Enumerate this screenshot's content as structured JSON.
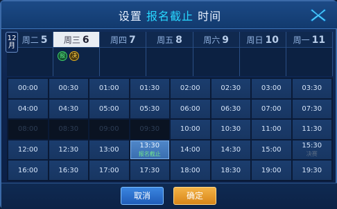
{
  "title": {
    "prefix": "设置",
    "highlight": "报名截止",
    "suffix": "时间"
  },
  "month_badge": {
    "number": "12",
    "unit": "月"
  },
  "days": [
    {
      "label": "周二",
      "date": "5",
      "selected": false
    },
    {
      "label": "周三",
      "date": "6",
      "selected": true,
      "badges": [
        "报",
        "决"
      ]
    },
    {
      "label": "周四",
      "date": "7",
      "selected": false
    },
    {
      "label": "周五",
      "date": "8",
      "selected": false
    },
    {
      "label": "周六",
      "date": "9",
      "selected": false
    },
    {
      "label": "周日",
      "date": "10",
      "selected": false
    },
    {
      "label": "周一",
      "date": "11",
      "selected": false
    }
  ],
  "slots": [
    {
      "time": "00:00",
      "state": "normal"
    },
    {
      "time": "00:30",
      "state": "normal"
    },
    {
      "time": "01:00",
      "state": "normal"
    },
    {
      "time": "01:30",
      "state": "normal"
    },
    {
      "time": "02:00",
      "state": "normal"
    },
    {
      "time": "02:30",
      "state": "normal"
    },
    {
      "time": "03:00",
      "state": "normal"
    },
    {
      "time": "03:30",
      "state": "normal"
    },
    {
      "time": "04:00",
      "state": "normal"
    },
    {
      "time": "04:30",
      "state": "normal"
    },
    {
      "time": "05:00",
      "state": "normal"
    },
    {
      "time": "05:30",
      "state": "normal"
    },
    {
      "time": "06:00",
      "state": "normal"
    },
    {
      "time": "06:30",
      "state": "normal"
    },
    {
      "time": "07:00",
      "state": "normal"
    },
    {
      "time": "07:30",
      "state": "normal"
    },
    {
      "time": "08:00",
      "state": "disabled"
    },
    {
      "time": "08:30",
      "state": "disabled"
    },
    {
      "time": "09:00",
      "state": "disabled"
    },
    {
      "time": "09:30",
      "state": "disabled"
    },
    {
      "time": "10:00",
      "state": "normal"
    },
    {
      "time": "10:30",
      "state": "normal"
    },
    {
      "time": "11:00",
      "state": "normal"
    },
    {
      "time": "11:30",
      "state": "normal"
    },
    {
      "time": "12:00",
      "state": "normal"
    },
    {
      "time": "12:30",
      "state": "normal"
    },
    {
      "time": "13:00",
      "state": "normal"
    },
    {
      "time": "13:30",
      "state": "active",
      "note": "报名截止"
    },
    {
      "time": "14:00",
      "state": "normal"
    },
    {
      "time": "14:30",
      "state": "normal"
    },
    {
      "time": "15:00",
      "state": "normal"
    },
    {
      "time": "15:30",
      "state": "normal",
      "note": "决赛",
      "note_dim": true
    },
    {
      "time": "16:00",
      "state": "normal"
    },
    {
      "time": "16:30",
      "state": "normal"
    },
    {
      "time": "17:00",
      "state": "normal"
    },
    {
      "time": "17:30",
      "state": "normal"
    },
    {
      "time": "18:00",
      "state": "normal"
    },
    {
      "time": "18:30",
      "state": "normal"
    },
    {
      "time": "19:00",
      "state": "normal"
    },
    {
      "time": "19:30",
      "state": "normal"
    }
  ],
  "buttons": {
    "cancel": "取消",
    "confirm": "确定"
  },
  "colors": {
    "accent": "#28d7ff",
    "confirm": "#e89a2a",
    "cancel": "#2f74d0",
    "active_slot": "#4a80c2"
  },
  "icons": {
    "close": "close-x-icon"
  }
}
